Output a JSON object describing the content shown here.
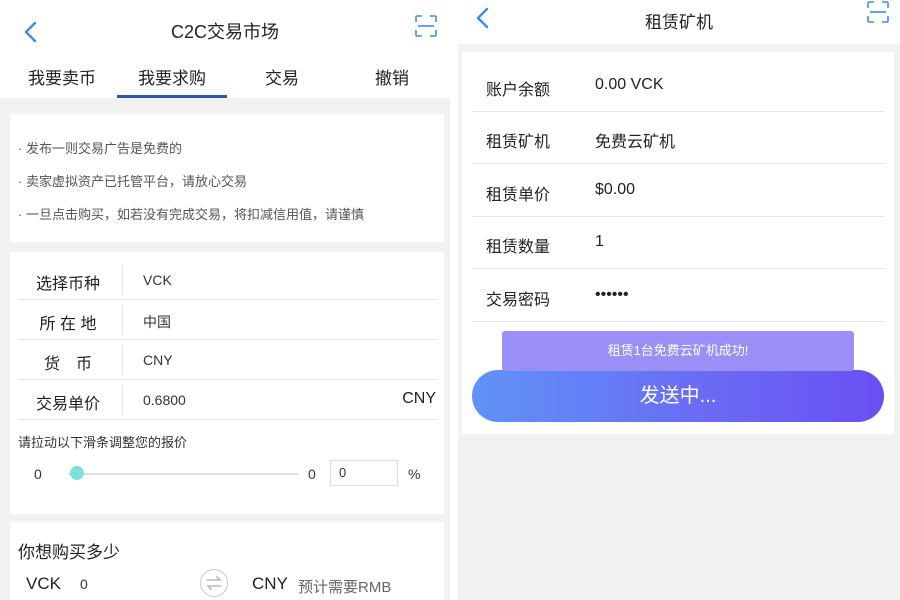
{
  "left": {
    "title": "C2C交易市场",
    "tabs": [
      {
        "label": "我要卖币"
      },
      {
        "label": "我要求购"
      },
      {
        "label": "交易"
      },
      {
        "label": "撤销"
      }
    ],
    "active_tab": "我要求购",
    "notices": [
      "· 发布一则交易广告是免费的",
      "· 卖家虚拟资产已托管平台，请放心交易",
      "· 一旦点击购买，如若没有完成交易，将扣减信用值，请谨慎"
    ],
    "form": {
      "coin": {
        "label": "选择币种",
        "value": "VCK"
      },
      "location": {
        "label": "所 在 地",
        "value": "中国"
      },
      "currency": {
        "label": "货　币",
        "value": "CNY"
      },
      "price": {
        "label": "交易单价",
        "value": "0.6800",
        "unit": "CNY"
      }
    },
    "slider": {
      "hint": "请拉动以下滑条调整您的报价",
      "min_label": "0",
      "max_label": "0",
      "input_value": "0",
      "percent": "%",
      "level": 0
    },
    "buy": {
      "title": "你想购买多少",
      "vck_label": "VCK",
      "vck_value": "0",
      "cny_label": "CNY",
      "need_label": "预计需要RMB"
    },
    "colors": {
      "accent": "#2a5aa6",
      "icon_blue": "#3d8cf0",
      "slider_thumb": "#7ee0d8"
    }
  },
  "right": {
    "title": "租赁矿机",
    "rows": [
      {
        "label": "账户余额",
        "value": "0.00 VCK"
      },
      {
        "label": "租赁矿机",
        "value": "免费云矿机"
      },
      {
        "label": "租赁单价",
        "value": "$0.00"
      },
      {
        "label": "租赁数量",
        "value": "1"
      },
      {
        "label": "交易密码",
        "value": "••••••"
      }
    ],
    "toast": "租赁1台免费云矿机成功!",
    "send_button": "发送中...",
    "colors": {
      "toast_bg": "#9a8ef7",
      "button_start": "#5f93f6",
      "button_end": "#6a4ff3"
    }
  }
}
